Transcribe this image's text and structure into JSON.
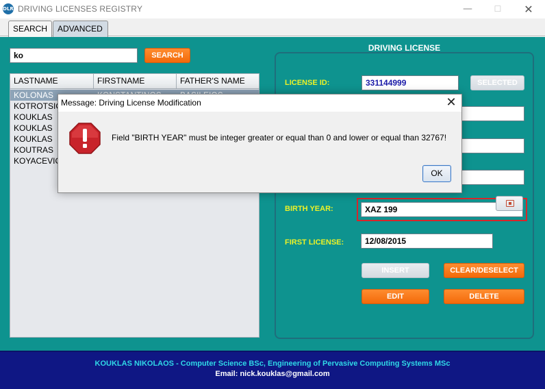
{
  "window": {
    "title": "DRIVING LICENSES REGISTRY",
    "icon_label": "DLR",
    "minimize_glyph": "—",
    "maximize_glyph": "☐",
    "close_glyph": "✕"
  },
  "tabs": [
    {
      "label": "SEARCH",
      "active": false
    },
    {
      "label": "ADVANCED",
      "active": true
    }
  ],
  "search": {
    "value": "ko",
    "button_label": "SEARCH"
  },
  "table": {
    "columns": [
      "LASTNAME",
      "FIRSTNAME",
      "FATHER'S NAME"
    ],
    "rows": [
      {
        "lastname": "KOLONAS",
        "firstname": "KONSTANTINOS",
        "fathers_name": "BASILEIOS",
        "selected": true
      },
      {
        "lastname": "KOTROTSIOS",
        "firstname": "",
        "fathers_name": ""
      },
      {
        "lastname": "KOUKLAS",
        "firstname": "",
        "fathers_name": ""
      },
      {
        "lastname": "KOUKLAS",
        "firstname": "",
        "fathers_name": ""
      },
      {
        "lastname": "KOUKLAS",
        "firstname": "",
        "fathers_name": ""
      },
      {
        "lastname": "KOUTRAS",
        "firstname": "",
        "fathers_name": ""
      },
      {
        "lastname": "KOYACEVIC",
        "firstname": "",
        "fathers_name": ""
      }
    ]
  },
  "license_panel": {
    "title": "DRIVING LICENSE",
    "license_id_label": "LICENSE ID:",
    "license_id_value": "331144999",
    "selected_button": "SELECTED",
    "birth_year_label": "BIRTH YEAR:",
    "birth_year_value": "XAZ 199",
    "first_license_label": "FIRST LICENSE:",
    "first_license_value": "12/08/2015",
    "insert_button": "INSERT",
    "clear_button": "CLEAR/DESELECT",
    "edit_button": "EDIT",
    "delete_button": "DELETE"
  },
  "footer": {
    "line1": "KOUKLAS NIKOLAOS - Computer Science BSc, Engineering of Pervasive Computing Systems MSc",
    "line2": "Email: nick.kouklas@gmail.com"
  },
  "dialog": {
    "title": "Message: Driving License Modification",
    "message": "Field \"BIRTH YEAR\" must be integer greater or equal than 0 and lower or equal than 32767!",
    "ok_label": "OK",
    "close_glyph": "✕",
    "icon": "error-icon"
  },
  "colors": {
    "main_bg": "#0e938f",
    "label_yellow": "#ecf227",
    "button_orange": "#f26a0a",
    "footer_bg": "#0f1784",
    "footer_accent": "#2fd8e6",
    "error_red": "#d9252a"
  }
}
